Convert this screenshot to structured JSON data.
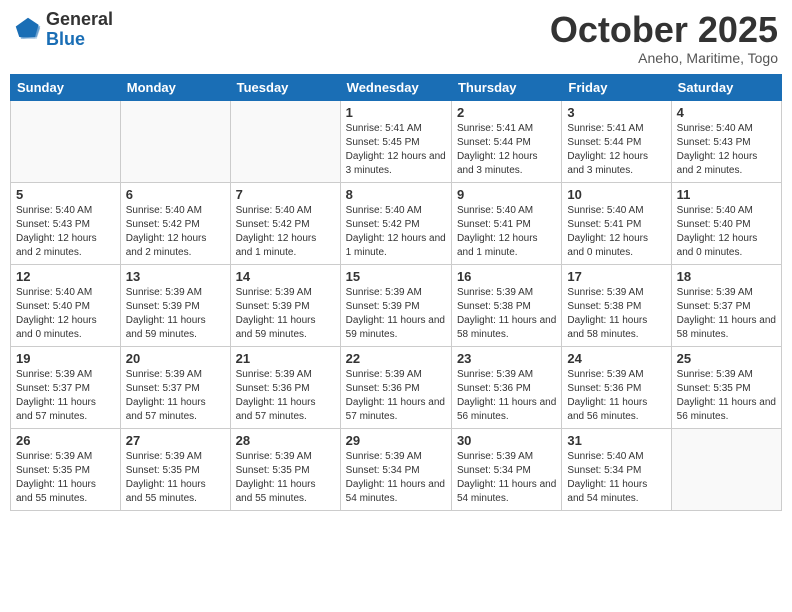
{
  "header": {
    "logo_general": "General",
    "logo_blue": "Blue",
    "month": "October 2025",
    "location": "Aneho, Maritime, Togo"
  },
  "weekdays": [
    "Sunday",
    "Monday",
    "Tuesday",
    "Wednesday",
    "Thursday",
    "Friday",
    "Saturday"
  ],
  "weeks": [
    [
      {
        "day": "",
        "info": ""
      },
      {
        "day": "",
        "info": ""
      },
      {
        "day": "",
        "info": ""
      },
      {
        "day": "1",
        "info": "Sunrise: 5:41 AM\nSunset: 5:45 PM\nDaylight: 12 hours\nand 3 minutes."
      },
      {
        "day": "2",
        "info": "Sunrise: 5:41 AM\nSunset: 5:44 PM\nDaylight: 12 hours\nand 3 minutes."
      },
      {
        "day": "3",
        "info": "Sunrise: 5:41 AM\nSunset: 5:44 PM\nDaylight: 12 hours\nand 3 minutes."
      },
      {
        "day": "4",
        "info": "Sunrise: 5:40 AM\nSunset: 5:43 PM\nDaylight: 12 hours\nand 2 minutes."
      }
    ],
    [
      {
        "day": "5",
        "info": "Sunrise: 5:40 AM\nSunset: 5:43 PM\nDaylight: 12 hours\nand 2 minutes."
      },
      {
        "day": "6",
        "info": "Sunrise: 5:40 AM\nSunset: 5:42 PM\nDaylight: 12 hours\nand 2 minutes."
      },
      {
        "day": "7",
        "info": "Sunrise: 5:40 AM\nSunset: 5:42 PM\nDaylight: 12 hours\nand 1 minute."
      },
      {
        "day": "8",
        "info": "Sunrise: 5:40 AM\nSunset: 5:42 PM\nDaylight: 12 hours\nand 1 minute."
      },
      {
        "day": "9",
        "info": "Sunrise: 5:40 AM\nSunset: 5:41 PM\nDaylight: 12 hours\nand 1 minute."
      },
      {
        "day": "10",
        "info": "Sunrise: 5:40 AM\nSunset: 5:41 PM\nDaylight: 12 hours\nand 0 minutes."
      },
      {
        "day": "11",
        "info": "Sunrise: 5:40 AM\nSunset: 5:40 PM\nDaylight: 12 hours\nand 0 minutes."
      }
    ],
    [
      {
        "day": "12",
        "info": "Sunrise: 5:40 AM\nSunset: 5:40 PM\nDaylight: 12 hours\nand 0 minutes."
      },
      {
        "day": "13",
        "info": "Sunrise: 5:39 AM\nSunset: 5:39 PM\nDaylight: 11 hours\nand 59 minutes."
      },
      {
        "day": "14",
        "info": "Sunrise: 5:39 AM\nSunset: 5:39 PM\nDaylight: 11 hours\nand 59 minutes."
      },
      {
        "day": "15",
        "info": "Sunrise: 5:39 AM\nSunset: 5:39 PM\nDaylight: 11 hours\nand 59 minutes."
      },
      {
        "day": "16",
        "info": "Sunrise: 5:39 AM\nSunset: 5:38 PM\nDaylight: 11 hours\nand 58 minutes."
      },
      {
        "day": "17",
        "info": "Sunrise: 5:39 AM\nSunset: 5:38 PM\nDaylight: 11 hours\nand 58 minutes."
      },
      {
        "day": "18",
        "info": "Sunrise: 5:39 AM\nSunset: 5:37 PM\nDaylight: 11 hours\nand 58 minutes."
      }
    ],
    [
      {
        "day": "19",
        "info": "Sunrise: 5:39 AM\nSunset: 5:37 PM\nDaylight: 11 hours\nand 57 minutes."
      },
      {
        "day": "20",
        "info": "Sunrise: 5:39 AM\nSunset: 5:37 PM\nDaylight: 11 hours\nand 57 minutes."
      },
      {
        "day": "21",
        "info": "Sunrise: 5:39 AM\nSunset: 5:36 PM\nDaylight: 11 hours\nand 57 minutes."
      },
      {
        "day": "22",
        "info": "Sunrise: 5:39 AM\nSunset: 5:36 PM\nDaylight: 11 hours\nand 57 minutes."
      },
      {
        "day": "23",
        "info": "Sunrise: 5:39 AM\nSunset: 5:36 PM\nDaylight: 11 hours\nand 56 minutes."
      },
      {
        "day": "24",
        "info": "Sunrise: 5:39 AM\nSunset: 5:36 PM\nDaylight: 11 hours\nand 56 minutes."
      },
      {
        "day": "25",
        "info": "Sunrise: 5:39 AM\nSunset: 5:35 PM\nDaylight: 11 hours\nand 56 minutes."
      }
    ],
    [
      {
        "day": "26",
        "info": "Sunrise: 5:39 AM\nSunset: 5:35 PM\nDaylight: 11 hours\nand 55 minutes."
      },
      {
        "day": "27",
        "info": "Sunrise: 5:39 AM\nSunset: 5:35 PM\nDaylight: 11 hours\nand 55 minutes."
      },
      {
        "day": "28",
        "info": "Sunrise: 5:39 AM\nSunset: 5:35 PM\nDaylight: 11 hours\nand 55 minutes."
      },
      {
        "day": "29",
        "info": "Sunrise: 5:39 AM\nSunset: 5:34 PM\nDaylight: 11 hours\nand 54 minutes."
      },
      {
        "day": "30",
        "info": "Sunrise: 5:39 AM\nSunset: 5:34 PM\nDaylight: 11 hours\nand 54 minutes."
      },
      {
        "day": "31",
        "info": "Sunrise: 5:40 AM\nSunset: 5:34 PM\nDaylight: 11 hours\nand 54 minutes."
      },
      {
        "day": "",
        "info": ""
      }
    ]
  ]
}
